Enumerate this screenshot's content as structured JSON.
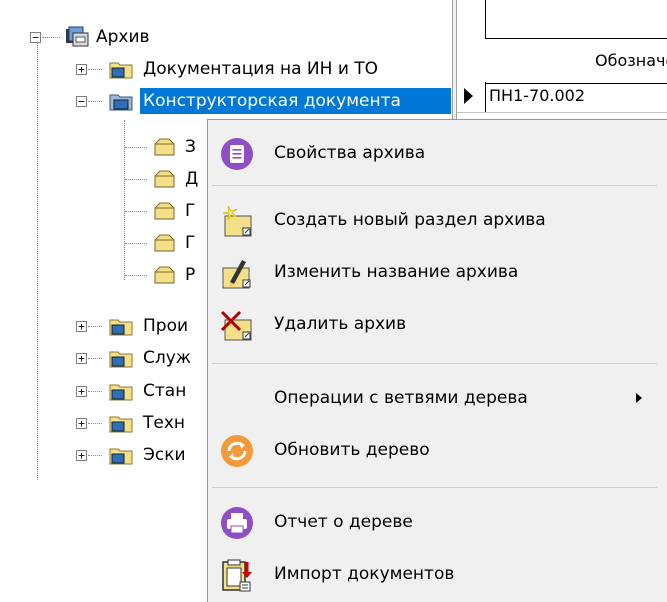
{
  "tree": {
    "root": {
      "label": "Архив",
      "expander": "−"
    },
    "items": [
      {
        "label": "Документация на ИН и ТО",
        "expander": "+"
      },
      {
        "label": "Конструкторская документа",
        "expander": "−"
      },
      {
        "label": "З"
      },
      {
        "label": "Д"
      },
      {
        "label": "Г"
      },
      {
        "label": "Г"
      },
      {
        "label": "Р"
      },
      {
        "label": "Прои",
        "expander": "+"
      },
      {
        "label": "Служ",
        "expander": "+"
      },
      {
        "label": "Стан",
        "expander": "+"
      },
      {
        "label": "Техн",
        "expander": "+"
      },
      {
        "label": "Эски",
        "expander": "+"
      }
    ]
  },
  "grid": {
    "column_header": "Обозначе",
    "row1_cell": "ПН1-70.002"
  },
  "context_menu": {
    "items": [
      {
        "label": "Свойства архива",
        "icon": "archive-properties-icon"
      },
      {
        "label": "Создать новый раздел архива",
        "icon": "new-section-icon"
      },
      {
        "label": "Изменить название архива",
        "icon": "rename-archive-icon"
      },
      {
        "label": "Удалить архив",
        "icon": "delete-archive-icon"
      },
      {
        "label": "Операции с ветвями дерева",
        "icon": "",
        "submenu": true
      },
      {
        "label": "Обновить дерево",
        "icon": "refresh-icon"
      },
      {
        "label": "Отчет о дереве",
        "icon": "print-report-icon"
      },
      {
        "label": "Импорт документов",
        "icon": "import-documents-icon"
      }
    ]
  },
  "colors": {
    "selection": "#0078d7",
    "menu_bg": "#f0f0f0",
    "folder": "#f5e08a",
    "properties_purple": "#8e4ec6",
    "refresh_orange": "#f29a3a"
  }
}
